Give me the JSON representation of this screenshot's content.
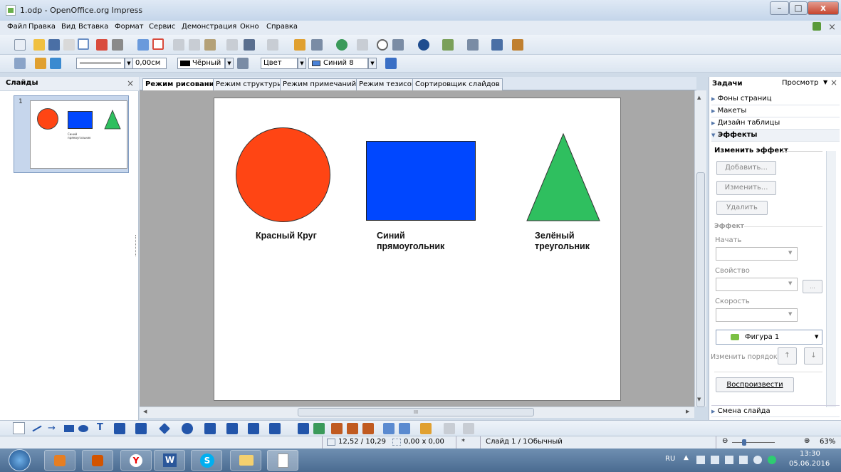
{
  "window": {
    "title": "1.odp - OpenOffice.org Impress",
    "min": "–",
    "max": "□",
    "close": "x"
  },
  "menu": {
    "items": [
      "Файл",
      "Правка",
      "Вид",
      "Вставка",
      "Формат",
      "Сервис",
      "Демонстрация",
      "Окно",
      "Справка"
    ],
    "close": "×"
  },
  "lineprops": {
    "width": "0,00см",
    "line_color": "Чёрный",
    "fill_type": "Цвет",
    "fill_color": "Синий 8"
  },
  "slides_panel": {
    "title": "Слайды",
    "close": "×",
    "slide_number": "1",
    "thumb_text": "Синий прямоугольник"
  },
  "view_tabs": [
    "Режим рисования",
    "Режим структуры",
    "Режим примечаний",
    "Режим тезисов",
    "Сортировщик слайдов"
  ],
  "slide": {
    "labels": {
      "circle": "Красный Круг",
      "rect_line1": "Синий",
      "rect_line2": "прямоугольник",
      "tri_line1": "Зелёный",
      "tri_line2": "треугольник"
    }
  },
  "colors": {
    "circle": "#ff4514",
    "rectangle": "#0047ff",
    "triangle": "#2fbf5f"
  },
  "task_panel": {
    "title": "Задачи",
    "view": "Просмотр",
    "close": "×",
    "sections": [
      "Фоны страниц",
      "Макеты",
      "Дизайн таблицы",
      "Эффекты"
    ],
    "change_effect": "Изменить эффект",
    "add": "Добавить...",
    "modify": "Изменить...",
    "remove": "Удалить",
    "effect": "Эффект",
    "start": "Начать",
    "property": "Свойство",
    "speed": "Скорость",
    "shape_item": "Фигура 1",
    "reorder": "Изменить порядок:",
    "play": "Воспроизвести",
    "slide_transition": "Смена слайда"
  },
  "hscroll": {
    "grip": "III"
  },
  "status": {
    "position": "12,52 / 10,29",
    "size": "0,00 x 0,00",
    "modified": "*",
    "slide": "Слайд 1 / 1",
    "layout": "Обычный",
    "zoom": "63%"
  },
  "taskbar": {
    "lang": "RU",
    "time": "13:30",
    "date": "05.06.2016"
  }
}
